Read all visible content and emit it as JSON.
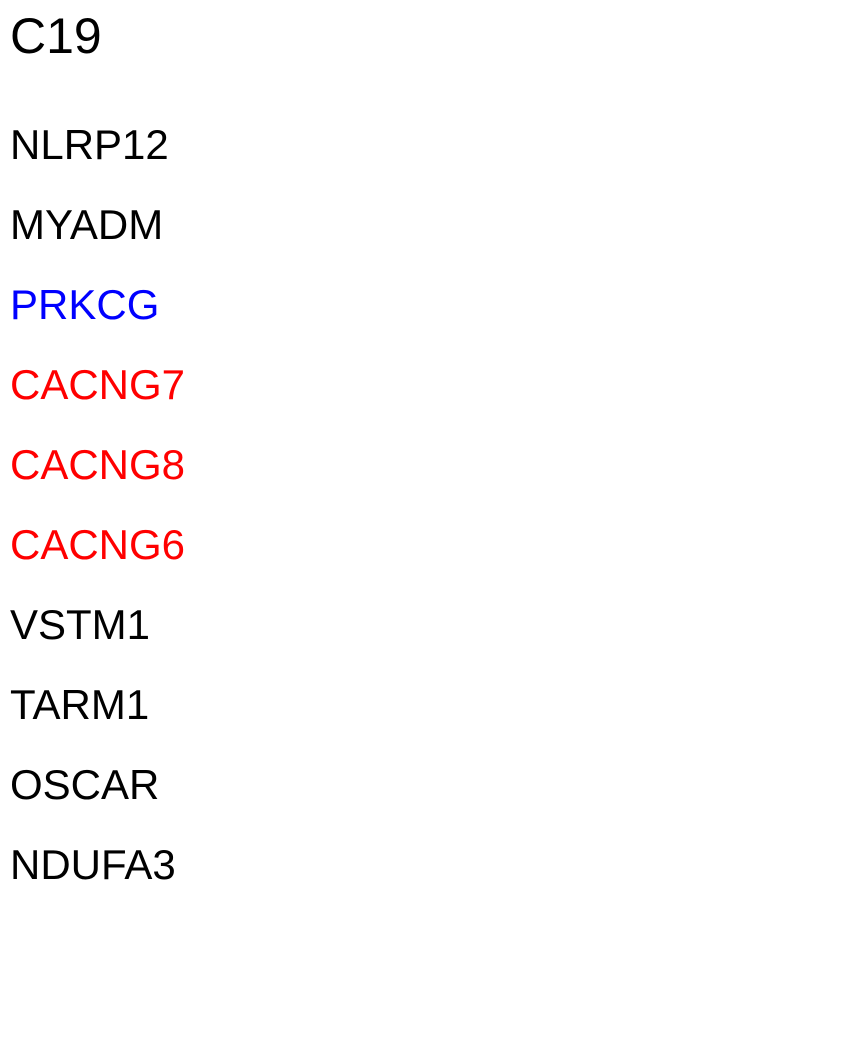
{
  "heading": "C19",
  "genes": [
    {
      "name": "NLRP12",
      "color": "#000000"
    },
    {
      "name": "MYADM",
      "color": "#000000"
    },
    {
      "name": "PRKCG",
      "color": "#0000ff"
    },
    {
      "name": "CACNG7",
      "color": "#ff0000"
    },
    {
      "name": "CACNG8",
      "color": "#ff0000"
    },
    {
      "name": "CACNG6",
      "color": "#ff0000"
    },
    {
      "name": "VSTM1",
      "color": "#000000"
    },
    {
      "name": "TARM1",
      "color": "#000000"
    },
    {
      "name": "OSCAR",
      "color": "#000000"
    },
    {
      "name": "NDUFA3",
      "color": "#000000"
    }
  ]
}
